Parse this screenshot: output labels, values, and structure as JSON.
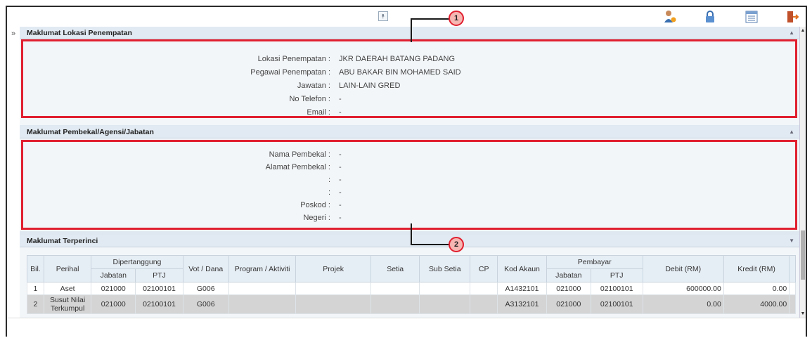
{
  "sections": {
    "lokasi": {
      "title": "Maklumat Lokasi Penempatan",
      "fields": [
        {
          "label": "Lokasi Penempatan :",
          "value": "JKR DAERAH BATANG PADANG"
        },
        {
          "label": "Pegawai Penempatan :",
          "value": "ABU BAKAR BIN MOHAMED SAID"
        },
        {
          "label": "Jawatan :",
          "value": "LAIN-LAIN GRED"
        },
        {
          "label": "No Telefon :",
          "value": "-"
        },
        {
          "label": "Email :",
          "value": "-"
        }
      ]
    },
    "pembekal": {
      "title": "Maklumat Pembekal/Agensi/Jabatan",
      "fields": [
        {
          "label": "Nama Pembekal :",
          "value": "-"
        },
        {
          "label": "Alamat Pembekal :",
          "value": "-"
        },
        {
          "label": ":",
          "value": "-"
        },
        {
          "label": ":",
          "value": "-"
        },
        {
          "label": "Poskod :",
          "value": "-"
        },
        {
          "label": "Negeri :",
          "value": "-"
        }
      ]
    },
    "terperinci": {
      "title": "Maklumat Terperinci",
      "headers": {
        "bil": "Bil.",
        "perihal": "Perihal",
        "dipertanggung": "Dipertanggung",
        "jabatan": "Jabatan",
        "ptj": "PTJ",
        "vot": "Vot / Dana",
        "program": "Program / Aktiviti",
        "projek": "Projek",
        "setia": "Setia",
        "subsetia": "Sub Setia",
        "cp": "CP",
        "kodakaun": "Kod Akaun",
        "pembayar": "Pembayar",
        "pjabatan": "Jabatan",
        "pptj": "PTJ",
        "debit": "Debit (RM)",
        "kredit": "Kredit (RM)"
      },
      "rows": [
        {
          "bil": "1",
          "perihal": "Aset",
          "jabatan": "021000",
          "ptj": "02100101",
          "vot": "G006",
          "program": "",
          "projek": "",
          "setia": "",
          "subsetia": "",
          "cp": "",
          "kodakaun": "A1432101",
          "pjabatan": "021000",
          "pptj": "02100101",
          "debit": "600000.00",
          "kredit": "0.00"
        },
        {
          "bil": "2",
          "perihal": "Susut Nilai Terkumpul",
          "jabatan": "021000",
          "ptj": "02100101",
          "vot": "G006",
          "program": "",
          "projek": "",
          "setia": "",
          "subsetia": "",
          "cp": "",
          "kodakaun": "A3132101",
          "pjabatan": "021000",
          "pptj": "02100101",
          "debit": "0.00",
          "kredit": "4000.00"
        }
      ]
    }
  },
  "callouts": [
    "1",
    "2"
  ],
  "icons": {
    "collapse": "double-chevron-up-icon",
    "sidebar": "double-chevron-right-icon",
    "user": "user-icon",
    "lock": "lock-icon",
    "list": "list-icon",
    "logout": "logout-icon"
  },
  "colors": {
    "highlight": "#e02030",
    "header_bg": "#e1eaf2",
    "selected_row": "#d4d4d4"
  }
}
